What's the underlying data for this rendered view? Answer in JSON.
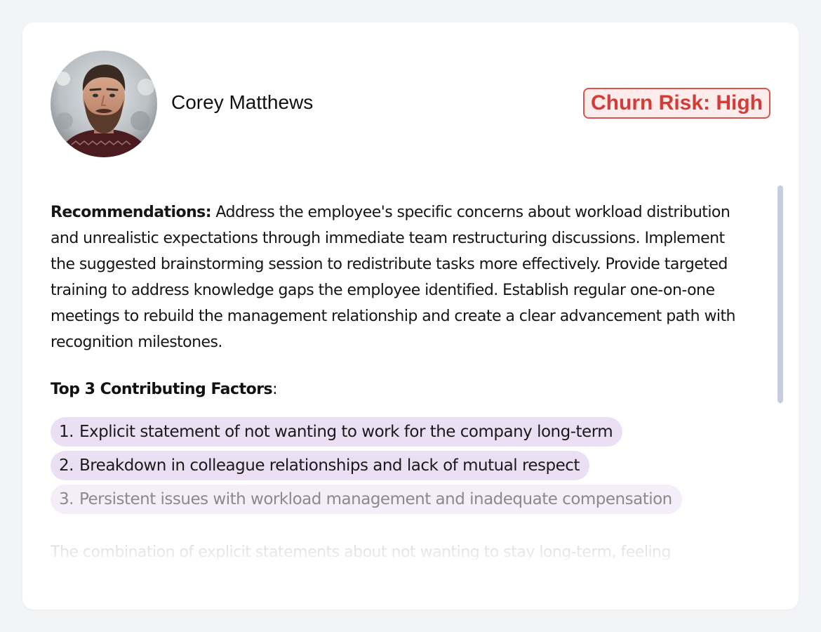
{
  "employee": {
    "name": "Corey Matthews",
    "avatar_alt": "Corey Matthews"
  },
  "risk": {
    "label": "Churn Risk: High",
    "color": "#d43c38",
    "background": "#fdecec"
  },
  "recommendations": {
    "label": "Recommendations:",
    "text": " Address the employee's specific concerns about workload distribution and unrealistic expectations through immediate team restructuring discussions. Implement the suggested brainstorming session to redistribute tasks more effectively. Provide targeted training to address knowledge gaps the employee identified. Establish regular one-on-one meetings to rebuild the management relationship and create a clear advancement path with recognition milestones."
  },
  "factors": {
    "heading": "Top 3 Contributing Factors",
    "heading_suffix": ":",
    "items": [
      {
        "number": "1.",
        "text": "Explicit statement of not wanting to work for the company long-term"
      },
      {
        "number": "2.",
        "text": "Breakdown in colleague relationships and lack of mutual respect"
      },
      {
        "number": "3.",
        "text": "Persistent issues with workload management and inadequate compensation"
      }
    ],
    "highlight_color": "#ebe0f3"
  },
  "summary": {
    "text": "The combination of explicit statements about not wanting to stay long-term, feeling"
  },
  "scrollbar_color": "#c5cddf"
}
